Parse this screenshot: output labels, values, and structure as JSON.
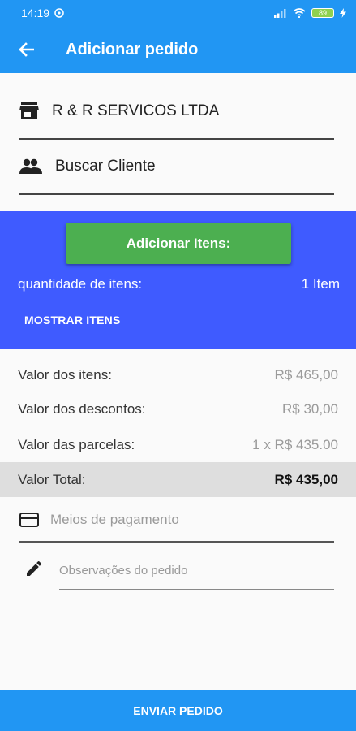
{
  "status_bar": {
    "time": "14:19",
    "battery": "89"
  },
  "app_bar": {
    "title": "Adicionar pedido"
  },
  "company": {
    "name": "R & R SERVICOS LTDA"
  },
  "client": {
    "placeholder": "Buscar Cliente"
  },
  "items_panel": {
    "add_button": "Adicionar Itens:",
    "quantity_label": "quantidade de itens:",
    "quantity_value": "1 Item",
    "show_items": "MOSTRAR ITENS"
  },
  "summary": {
    "items_label": "Valor dos itens:",
    "items_value": "R$ 465,00",
    "discounts_label": "Valor dos descontos:",
    "discounts_value": "R$ 30,00",
    "installments_label": "Valor das parcelas:",
    "installments_value": "1 x R$ 435.00",
    "total_label": "Valor Total:",
    "total_value": "R$ 435,00"
  },
  "payment": {
    "placeholder": "Meios de pagamento"
  },
  "notes": {
    "placeholder": "Observações do pedido"
  },
  "footer": {
    "send_button": "ENVIAR PEDIDO"
  },
  "colors": {
    "primary": "#2196f3",
    "panel": "#3f5bff",
    "add_button": "#4caf50",
    "total_row": "#dedede"
  }
}
